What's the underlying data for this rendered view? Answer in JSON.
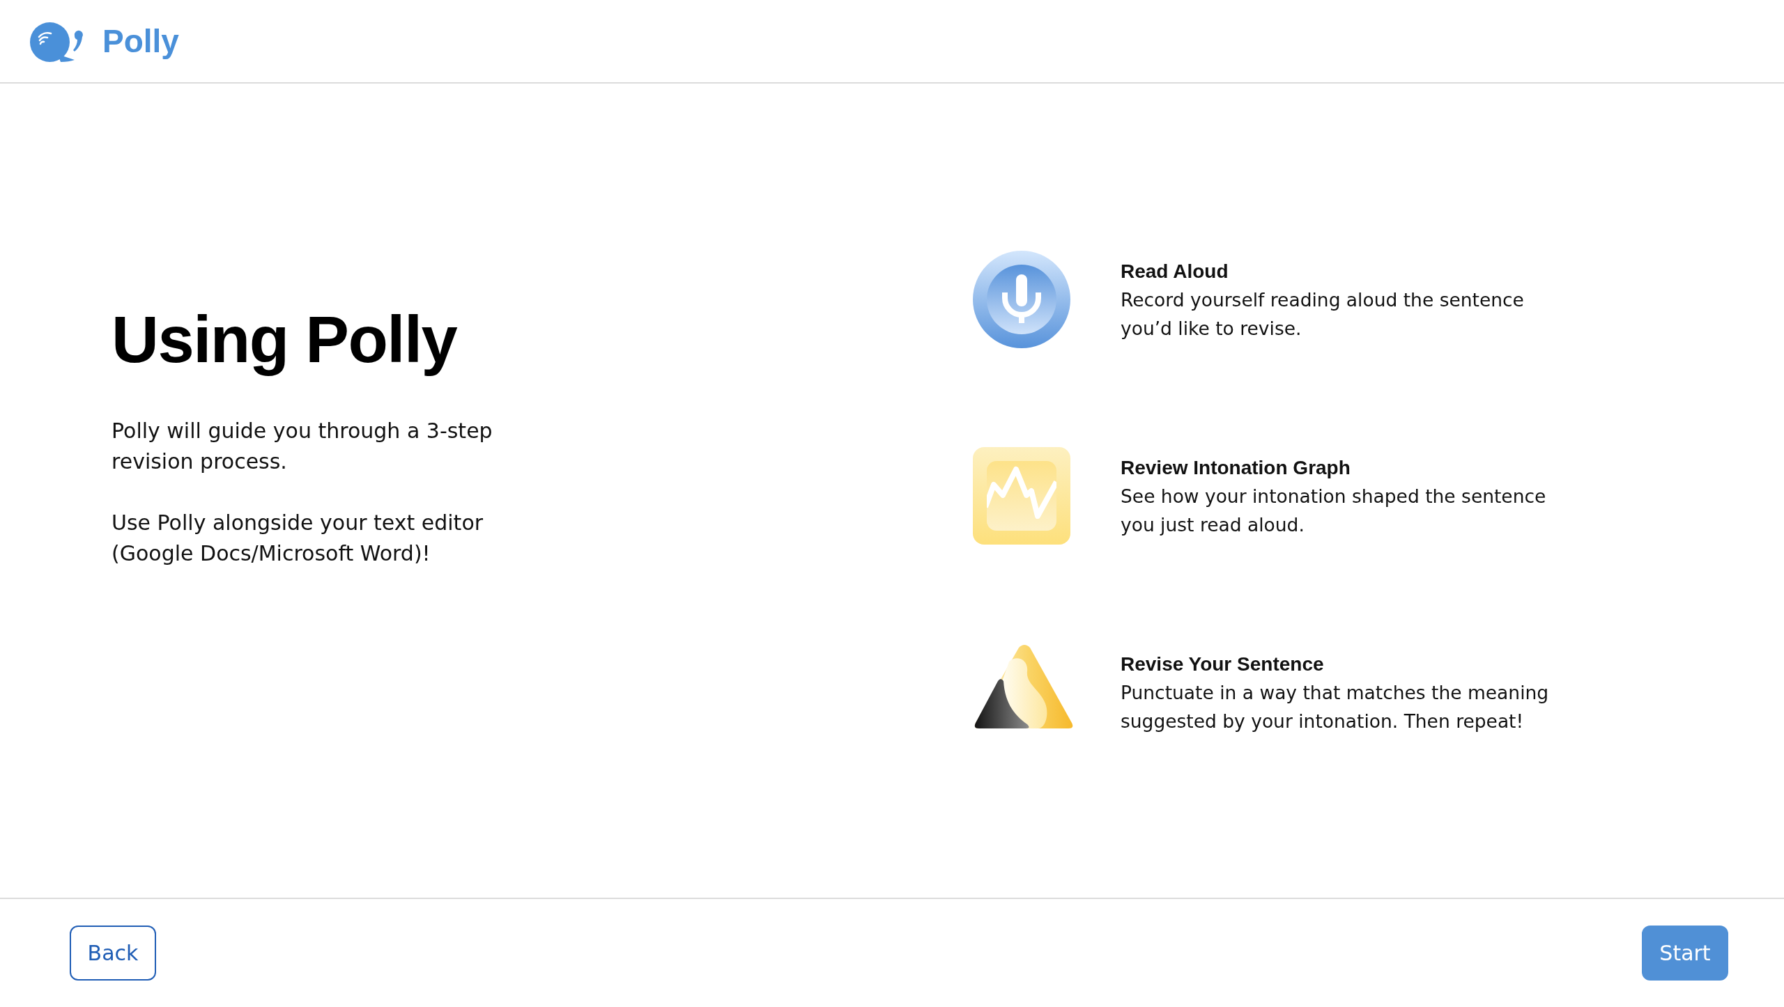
{
  "header": {
    "app_name": "Polly"
  },
  "intro": {
    "title": "Using Polly",
    "paragraphs": [
      "Polly will guide you through a 3-step revision process.",
      "Use Polly alongside your text editor (Google Docs/Microsoft Word)!"
    ]
  },
  "steps": [
    {
      "kind": "record",
      "title": "Read Aloud",
      "description": "Record yourself reading aloud the sentence you’d like to revise."
    },
    {
      "kind": "graph",
      "title": "Review Intonation Graph",
      "description": "See how your intonation shaped the sentence you just read aloud."
    },
    {
      "kind": "revise",
      "title": "Revise Your Sentence",
      "description": "Punctuate in a way that matches the meaning suggested by your intonation. Then repeat!"
    }
  ],
  "footer": {
    "buttons": [
      {
        "kind": "back",
        "label": "Back"
      },
      {
        "kind": "start",
        "label": "Start"
      }
    ]
  }
}
